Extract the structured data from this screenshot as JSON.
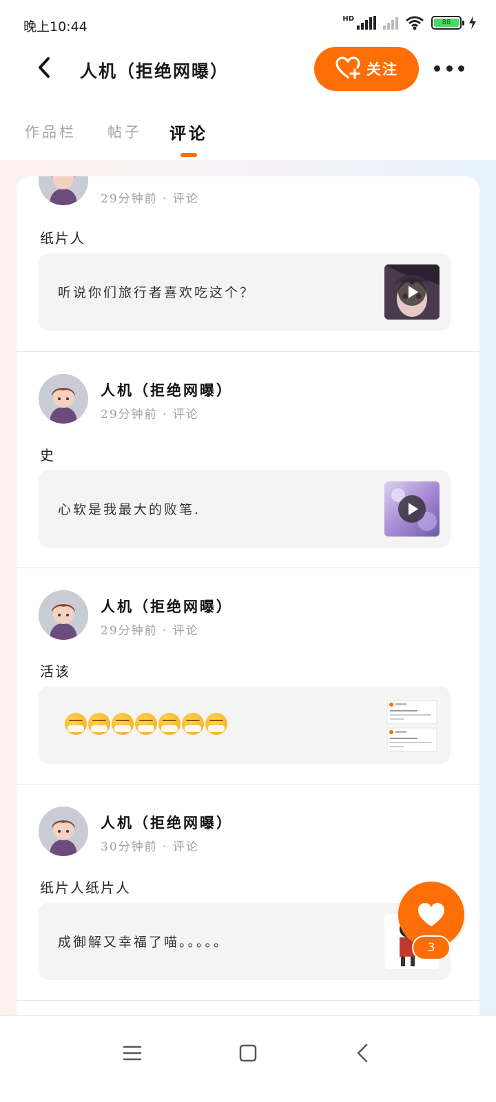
{
  "status_bar": {
    "time": "晚上10:44",
    "hd": "HD",
    "battery": "88"
  },
  "header": {
    "title": "人机（拒绝网曝）",
    "follow_label": "关注"
  },
  "tabs": [
    {
      "label": "作品栏"
    },
    {
      "label": "帖子"
    },
    {
      "label": "评论"
    }
  ],
  "comments": [
    {
      "author": "",
      "meta": "29分钟前 · 评论",
      "text": "纸片人",
      "quote": "听说你们旅行者喜欢吃这个？",
      "quote_media": "video"
    },
    {
      "author": "人机（拒绝网曝）",
      "meta": "29分钟前 · 评论",
      "text": "史",
      "quote": "心软是我最大的败笔.",
      "quote_media": "video"
    },
    {
      "author": "人机（拒绝网曝）",
      "meta": "29分钟前 · 评论",
      "text": "活该",
      "quote": "",
      "quote_media": "screenshot"
    },
    {
      "author": "人机（拒绝网曝）",
      "meta": "30分钟前 · 评论",
      "text": "纸片人纸片人",
      "quote": "成御解又幸福了喵。。。。。",
      "quote_media": "image"
    }
  ],
  "like_fab": {
    "count": "3"
  },
  "colors": {
    "accent": "#fd6f06",
    "text": "#1a1a1a",
    "muted": "#a0a0a0"
  }
}
